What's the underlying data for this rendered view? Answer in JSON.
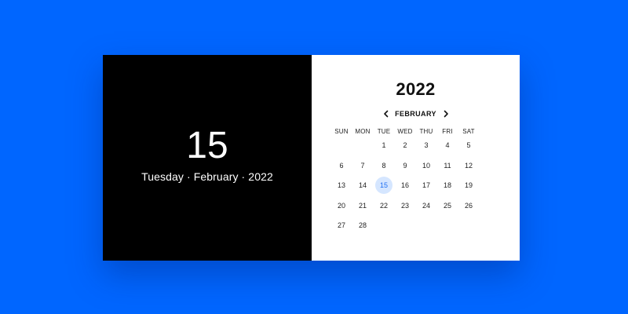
{
  "left": {
    "day": "15",
    "full_date": "Tuesday · February · 2022"
  },
  "calendar": {
    "year": "2022",
    "month": "FEBRUARY",
    "prev_icon": "chevron-left-icon",
    "next_icon": "chevron-right-icon",
    "weekdays": [
      "SUN",
      "MON",
      "TUE",
      "WED",
      "THU",
      "FRI",
      "SAT"
    ],
    "first_weekday_index": 2,
    "days": [
      "1",
      "2",
      "3",
      "4",
      "5",
      "6",
      "7",
      "8",
      "9",
      "10",
      "11",
      "12",
      "13",
      "14",
      "15",
      "16",
      "17",
      "18",
      "19",
      "20",
      "21",
      "22",
      "23",
      "24",
      "25",
      "26",
      "27",
      "28"
    ],
    "selected_day": "15",
    "selected_bg": "#d5e6ff",
    "selected_color": "#1f6ff2"
  },
  "colors": {
    "background": "#0066ff",
    "left_panel": "#000000",
    "right_panel": "#ffffff"
  }
}
